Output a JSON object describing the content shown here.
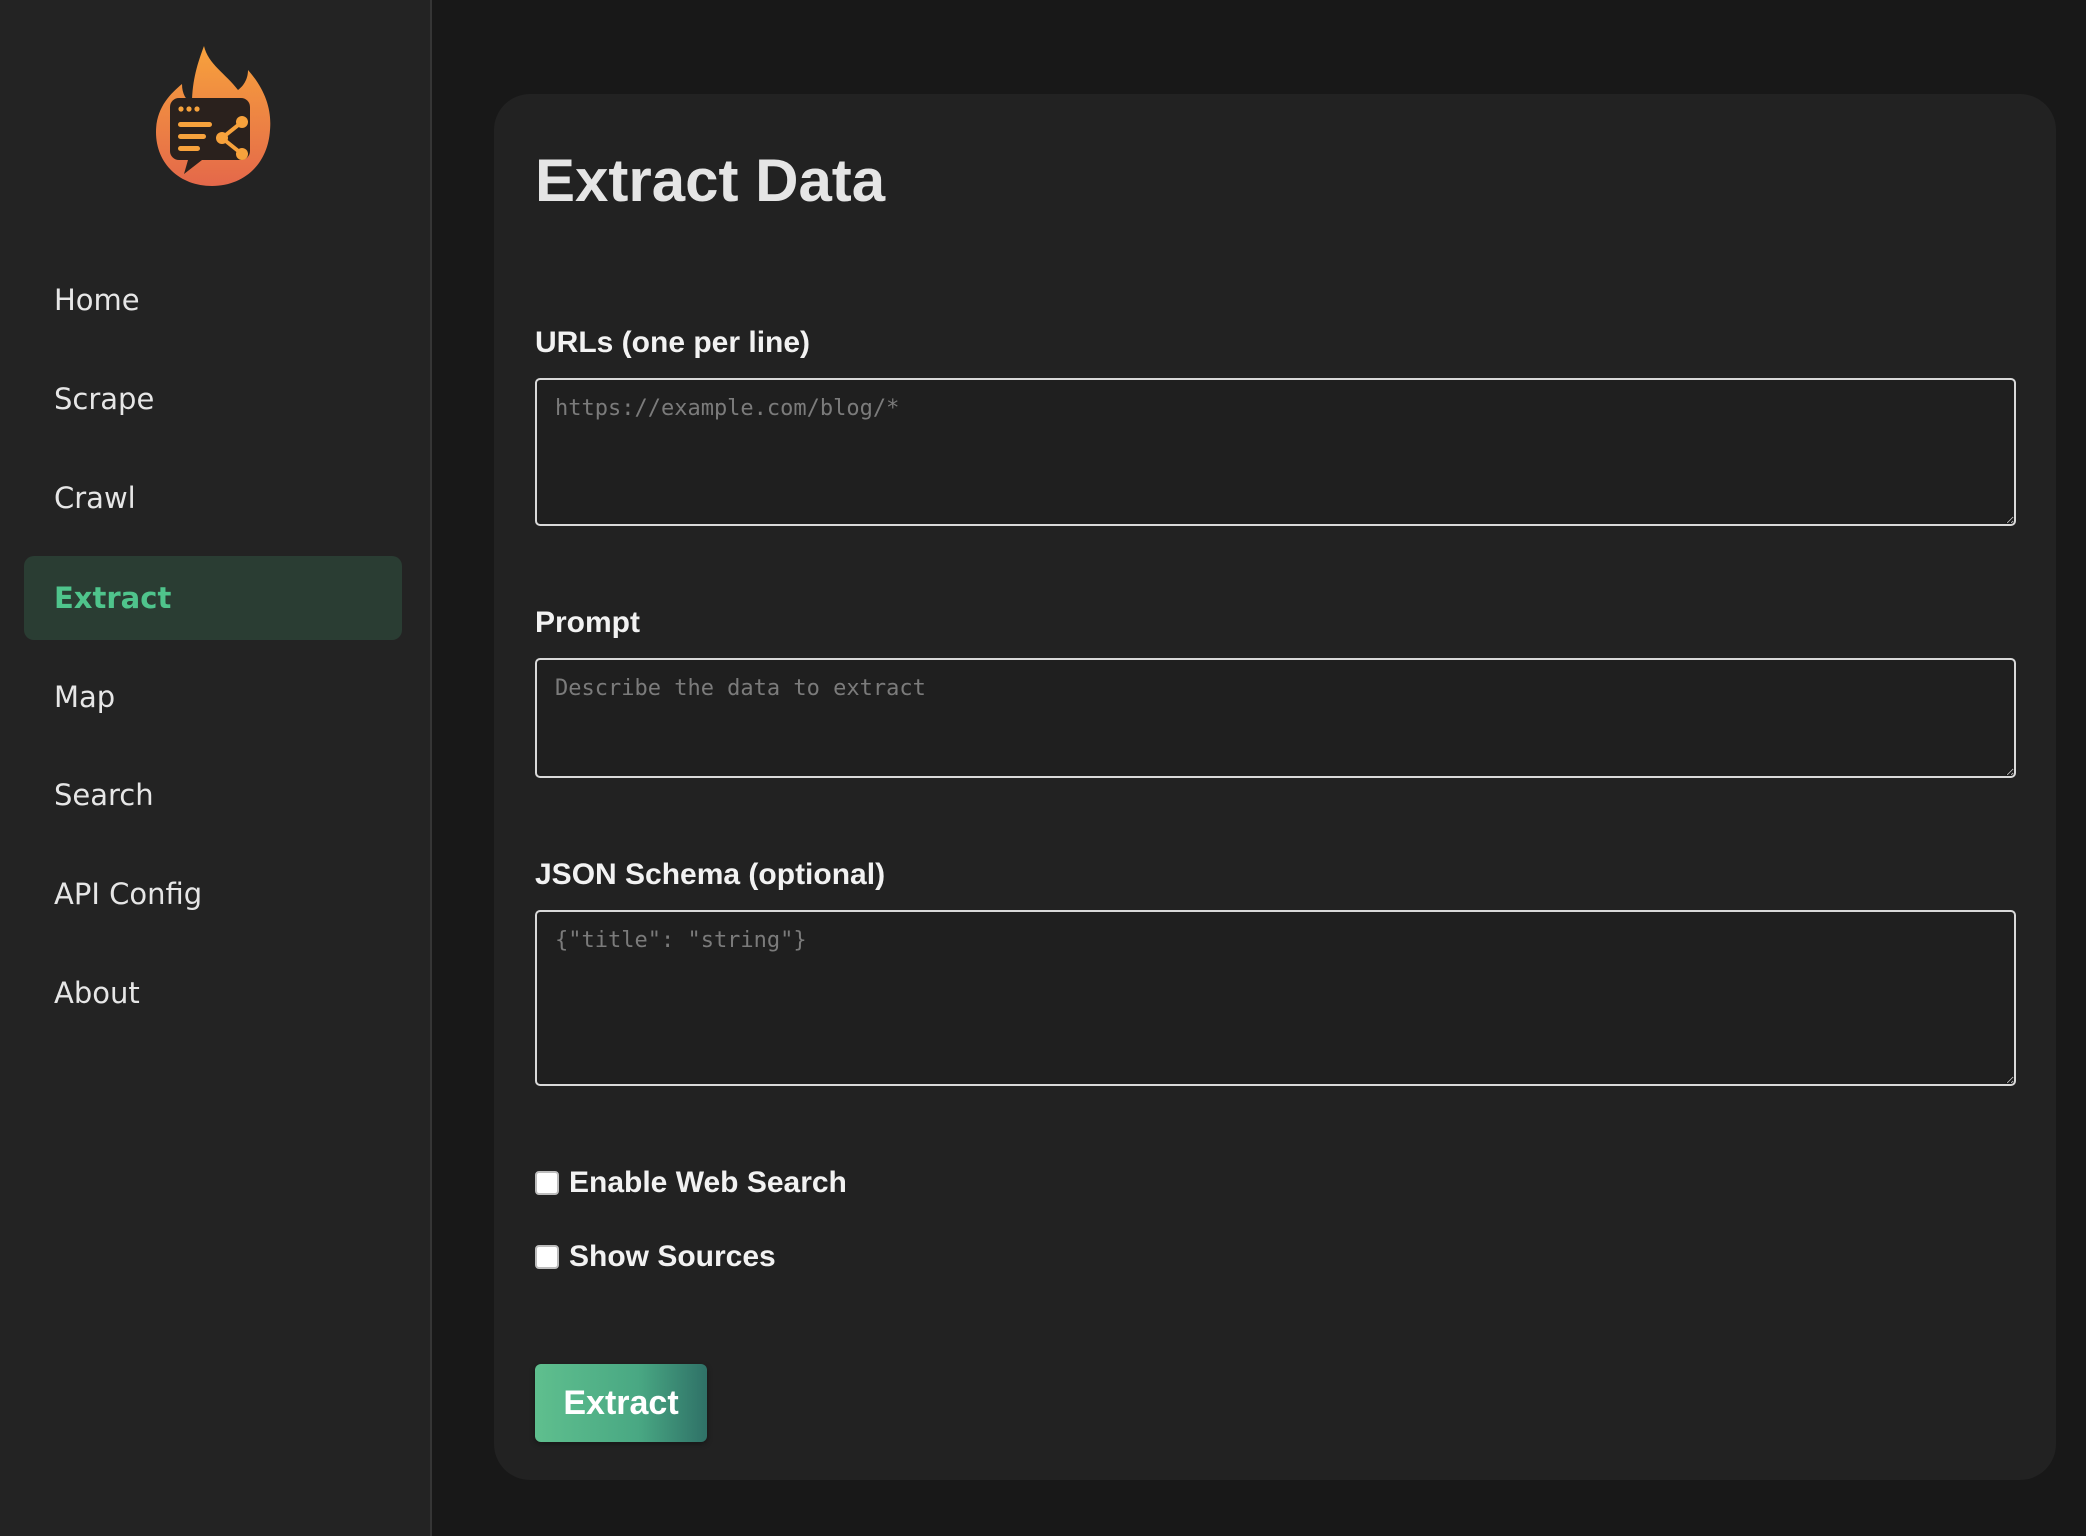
{
  "sidebar": {
    "logo_icon": "flame-chat-logo",
    "items": [
      {
        "label": "Home",
        "active": false
      },
      {
        "label": "Scrape",
        "active": false
      },
      {
        "label": "Crawl",
        "active": false
      },
      {
        "label": "Extract",
        "active": true
      },
      {
        "label": "Map",
        "active": false
      },
      {
        "label": "Search",
        "active": false
      },
      {
        "label": "API Config",
        "active": false
      },
      {
        "label": "About",
        "active": false
      }
    ]
  },
  "main": {
    "title": "Extract Data",
    "urls": {
      "label": "URLs (one per line)",
      "value": "",
      "placeholder": "https://example.com/blog/*"
    },
    "prompt": {
      "label": "Prompt",
      "value": "",
      "placeholder": "Describe the data to extract"
    },
    "schema": {
      "label": "JSON Schema (optional)",
      "value": "",
      "placeholder": "{\"title\": \"string\"}"
    },
    "options": {
      "web_search": {
        "label": "Enable Web Search",
        "checked": false
      },
      "show_sources": {
        "label": "Show Sources",
        "checked": false
      }
    },
    "extract_button": "Extract"
  },
  "colors": {
    "accent": "#4fc48c",
    "active_bg": "#2a3d33",
    "logo_orange": "#f08a3c"
  }
}
